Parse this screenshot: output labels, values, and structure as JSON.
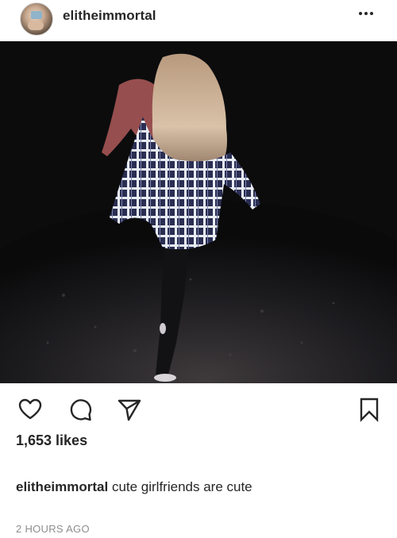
{
  "post": {
    "username": "elitheimmortal",
    "likes": "1,653 likes",
    "caption_user": "elitheimmortal",
    "caption_text": "cute girlfriends are cute",
    "timestamp": "2 HOURS AGO"
  },
  "icons": {
    "more": "more-options-icon",
    "like": "heart-icon",
    "comment": "comment-icon",
    "share": "share-icon",
    "save": "bookmark-icon"
  },
  "colors": {
    "text": "#262626",
    "muted": "#8e8e8e",
    "background": "#ffffff"
  }
}
